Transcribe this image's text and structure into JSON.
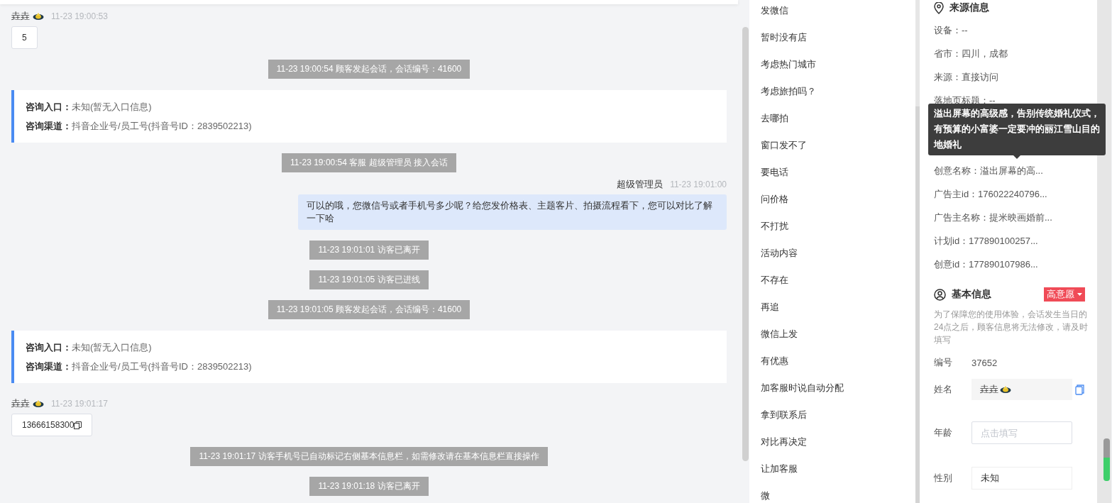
{
  "chat": {
    "messages": [
      {
        "kind": "customer",
        "name": "垚垚",
        "time": "11-23 19:00:53",
        "text": "5",
        "copy_icon": false
      },
      {
        "kind": "system",
        "text": "11-23 19:00:54 顾客发起会话，会话编号：41600"
      },
      {
        "kind": "source",
        "entry_label": "咨询入口：",
        "entry": "未知(暂无入口信息)",
        "channel_label": "咨询渠道：",
        "channel": "抖音企业号/员工号(抖音号ID：2839502213)"
      },
      {
        "kind": "system",
        "text": "11-23 19:00:54 客服 超级管理员 接入会话"
      },
      {
        "kind": "agent",
        "name": "超级管理员",
        "time": "11-23 19:01:00",
        "text": "可以的哦，您微信号或者手机号多少呢？给您发价格表、主题客片、拍摄流程看下，您可以对比了解一下哈"
      },
      {
        "kind": "system",
        "text": "11-23 19:01:01 访客已离开"
      },
      {
        "kind": "system",
        "text": "11-23 19:01:05 访客已进线"
      },
      {
        "kind": "system",
        "text": "11-23 19:01:05 顾客发起会话，会话编号：41600"
      },
      {
        "kind": "source",
        "entry_label": "咨询入口：",
        "entry": "未知(暂无入口信息)",
        "channel_label": "咨询渠道：",
        "channel": "抖音企业号/员工号(抖音号ID：2839502213)"
      },
      {
        "kind": "customer",
        "name": "垚垚",
        "time": "11-23 19:01:17",
        "text": "13666158300",
        "copy_icon": true
      },
      {
        "kind": "system",
        "text": "11-23 19:01:17 访客手机号已自动标记右侧基本信息栏，如需修改请在基本信息栏直接操作"
      },
      {
        "kind": "system",
        "text": "11-23 19:01:18 访客已离开"
      }
    ]
  },
  "quick_replies": [
    "发微信",
    "暂时没有店",
    "考虑热门城市",
    "考虑旅拍吗？",
    "去哪拍",
    "窗口发不了",
    "要电话",
    "问价格",
    "不打扰",
    "活动内容",
    "不存在",
    "再追",
    "微信上发",
    "有优惠",
    "加客服时说自动分配",
    "拿到联系后",
    "对比再决定",
    "让加客服",
    "微"
  ],
  "source_info": {
    "title": "来源信息",
    "rows": [
      "设备：--",
      "省市：四川，成都",
      "来源：直接访问",
      "落地页标题：--",
      "创意名称：溢出屏幕的高...",
      "广告主id：176022240796...",
      "广告主名称：提米映画婚前...",
      "计划id：177890100257...",
      "创意id：177890107986..."
    ]
  },
  "tooltip": {
    "text": "溢出屏幕的高级感，告别传统婚礼仪式，有预算的小富婆一定要冲的丽江雪山目的地婚礼"
  },
  "basic_info": {
    "title": "基本信息",
    "intent_badge": "高意愿",
    "note": "为了保障您的使用体验，会话发生当日的24点之后，顾客信息将无法修改，请及时填写",
    "fields": [
      {
        "kind": "static",
        "label": "编号",
        "value": "37652"
      },
      {
        "kind": "name",
        "label": "姓名",
        "value": "垚垚"
      },
      {
        "kind": "input",
        "label": "年龄",
        "placeholder": "点击填写"
      },
      {
        "kind": "select",
        "label": "性别",
        "value": "未知"
      }
    ]
  }
}
